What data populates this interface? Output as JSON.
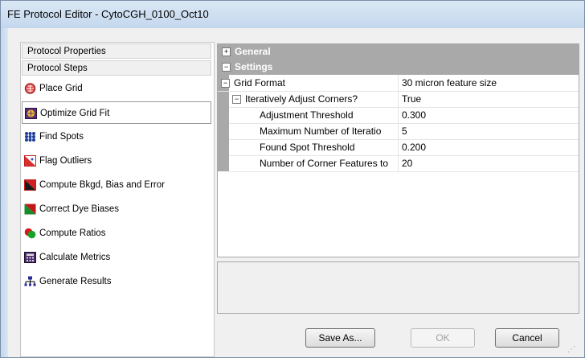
{
  "window": {
    "title": "FE Protocol Editor - CytoCGH_0100_Oct10"
  },
  "left_panel": {
    "protocol_properties": "Protocol Properties",
    "protocol_steps": "Protocol Steps",
    "steps": [
      {
        "label": "Place Grid",
        "icon": "place-grid-icon",
        "selected": false
      },
      {
        "label": "Optimize Grid Fit",
        "icon": "optimize-grid-fit-icon",
        "selected": true
      },
      {
        "label": "Find Spots",
        "icon": "find-spots-icon",
        "selected": false
      },
      {
        "label": "Flag Outliers",
        "icon": "flag-outliers-icon",
        "selected": false
      },
      {
        "label": "Compute Bkgd, Bias and Error",
        "icon": "compute-bkgd-icon",
        "selected": false
      },
      {
        "label": "Correct Dye Biases",
        "icon": "correct-dye-biases-icon",
        "selected": false
      },
      {
        "label": "Compute Ratios",
        "icon": "compute-ratios-icon",
        "selected": false
      },
      {
        "label": "Calculate Metrics",
        "icon": "calculate-metrics-icon",
        "selected": false
      },
      {
        "label": "Generate Results",
        "icon": "generate-results-icon",
        "selected": false
      }
    ]
  },
  "property_grid": {
    "categories": [
      {
        "label": "General",
        "expanded": false
      },
      {
        "label": "Settings",
        "expanded": true
      }
    ],
    "rows": [
      {
        "name": "Grid Format",
        "value": "30 micron feature size",
        "expander": "minus"
      },
      {
        "name": "Iteratively Adjust Corners?",
        "value": "True",
        "expander": "minus"
      },
      {
        "name": "Adjustment Threshold",
        "value": "0.300"
      },
      {
        "name": "Maximum Number of Iteratio",
        "value": "5"
      },
      {
        "name": "Found Spot Threshold",
        "value": "0.200"
      },
      {
        "name": "Number of Corner Features to",
        "value": "20"
      }
    ]
  },
  "buttons": {
    "save_as": "Save As...",
    "ok": "OK",
    "cancel": "Cancel"
  },
  "symbols": {
    "plus": "+",
    "minus": "−",
    "grip": "⋰"
  },
  "colors": {
    "category_bg": "#a9a9a9",
    "title_bar": "#c4d7ee"
  }
}
